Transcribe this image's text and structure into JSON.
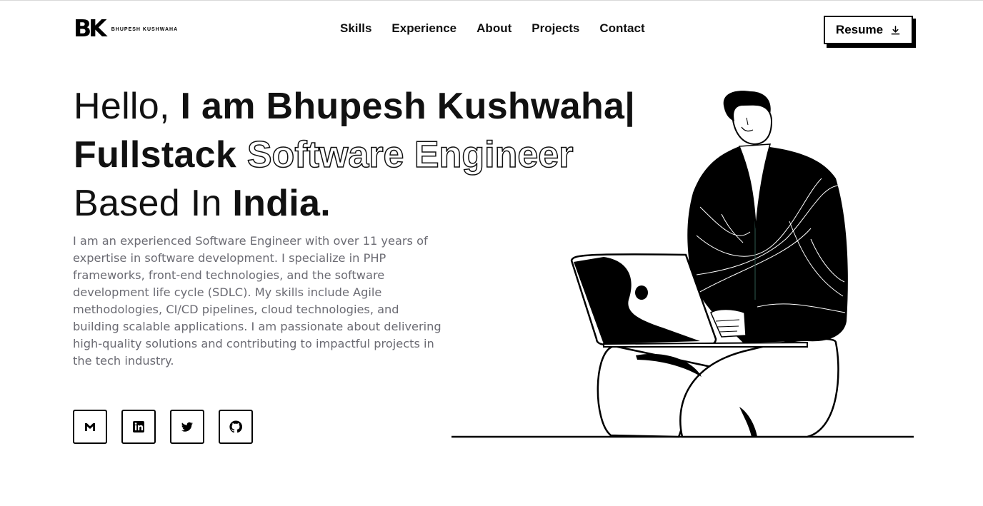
{
  "header": {
    "logo_mark_b": "B",
    "logo_mark_k": "K",
    "logo_name": "BHUPESH KUSHWAHA",
    "nav": [
      "Skills",
      "Experience",
      "About",
      "Projects",
      "Contact"
    ],
    "resume_label": "Resume"
  },
  "hero": {
    "line1_thin": "Hello, ",
    "line1_bold": "I am Bhupesh Kushwaha|",
    "line2_bold": "Fullstack ",
    "line2_outline": "Software Engineer",
    "line3_thin": "Based In ",
    "line3_bold": "India.",
    "description": "I am an experienced Software Engineer with over 11 years of expertise in software development. I specialize in PHP frameworks, front-end technologies, and the software development life cycle (SDLC). My skills include Agile methodologies, CI/CD pipelines, cloud technologies, and building scalable applications. I am passionate about delivering high-quality solutions and contributing to impactful projects in the tech industry."
  },
  "socials": [
    {
      "icon": "gmail-icon"
    },
    {
      "icon": "linkedin-icon"
    },
    {
      "icon": "twitter-icon"
    },
    {
      "icon": "github-icon"
    }
  ],
  "colors": {
    "text": "#111111",
    "muted": "#6b6b73",
    "background": "#ffffff",
    "accent": "#000000"
  }
}
